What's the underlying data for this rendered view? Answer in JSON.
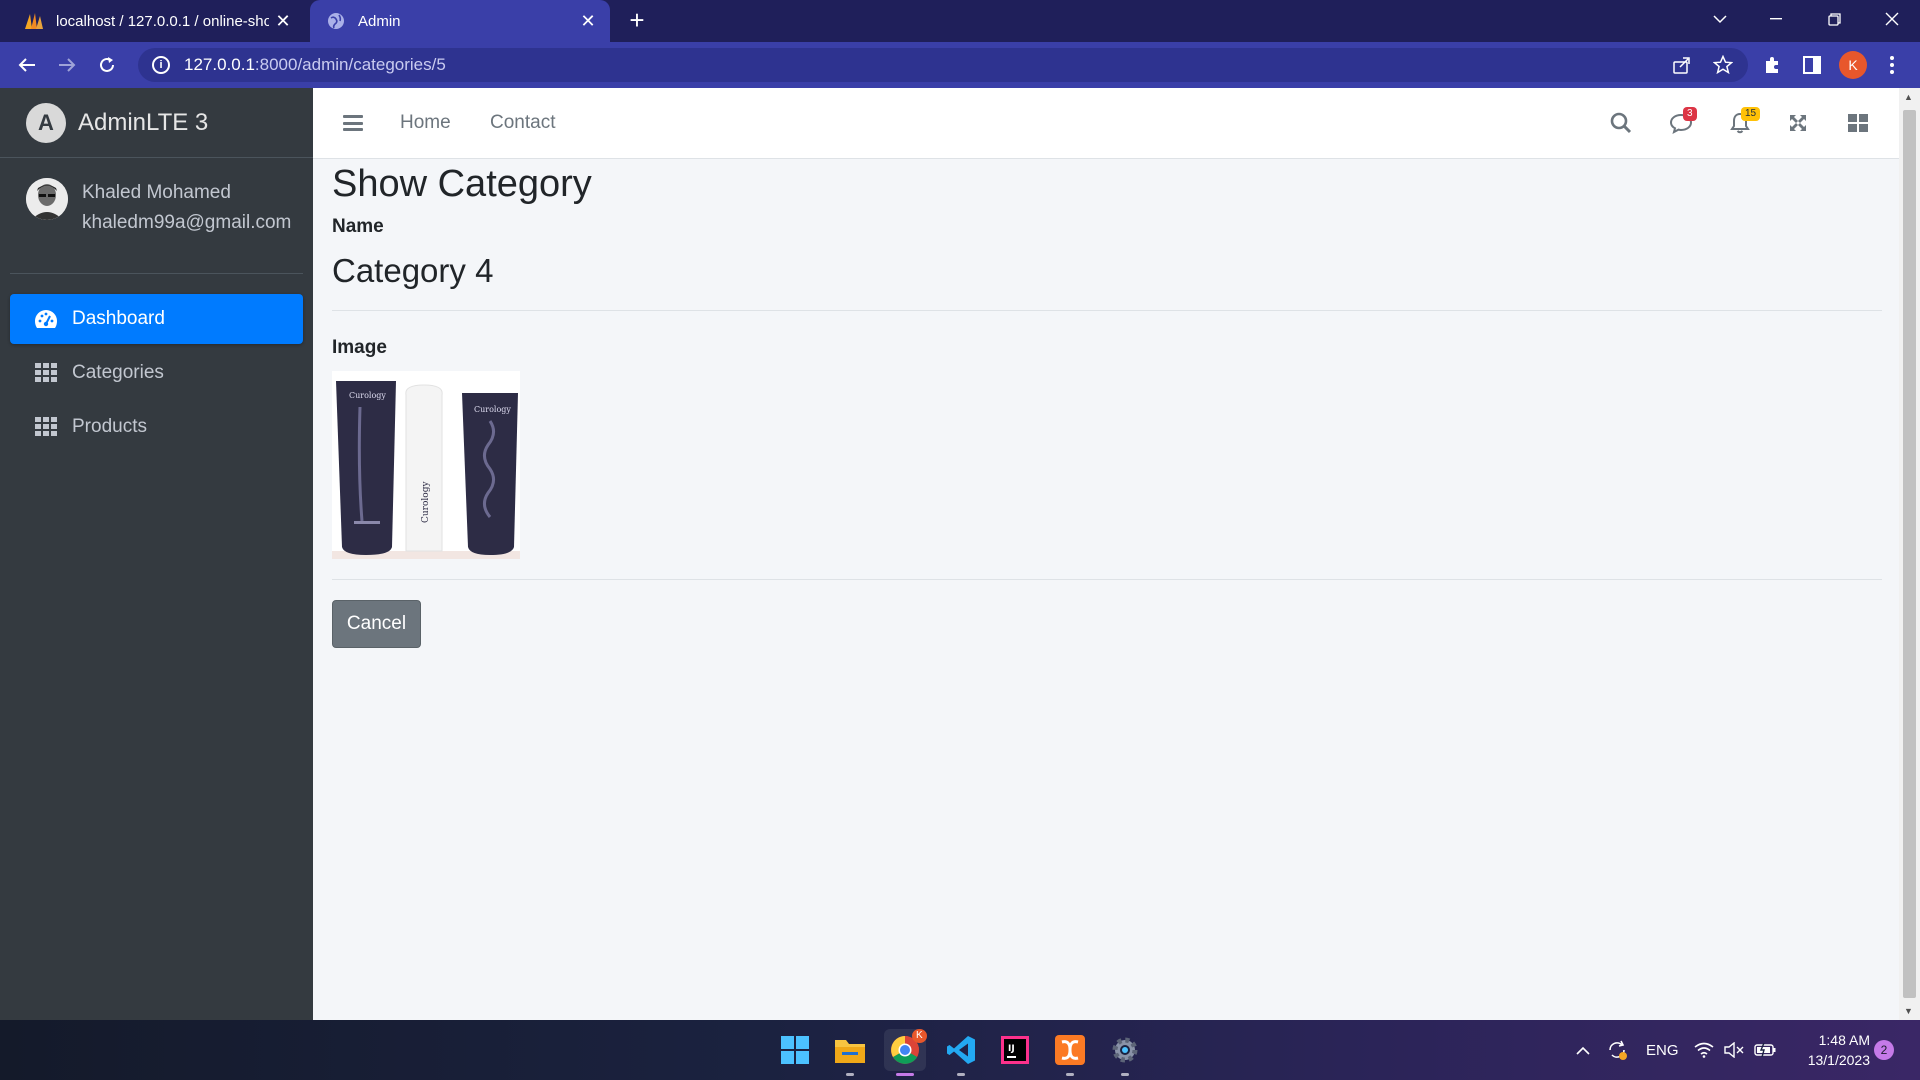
{
  "browser": {
    "tabs": [
      {
        "title": "localhost / 127.0.0.1 / online-sho",
        "favicon": "phpmyadmin-icon",
        "active": false
      },
      {
        "title": "Admin",
        "favicon": "globe-icon",
        "active": true
      }
    ],
    "address": {
      "host": "127.0.0.1",
      "path": ":8000/admin/categories/5"
    },
    "profile_initial": "K"
  },
  "sidebar": {
    "brand": "AdminLTE 3",
    "brand_logo_letter": "A",
    "user": {
      "name": "Khaled Mohamed",
      "email": "khaledm99a@gmail.com"
    },
    "items": [
      {
        "label": "Dashboard",
        "icon": "tachometer-icon",
        "active": true
      },
      {
        "label": "Categories",
        "icon": "grid-icon",
        "active": false
      },
      {
        "label": "Products",
        "icon": "grid-icon",
        "active": false
      }
    ]
  },
  "navbar": {
    "links": [
      "Home",
      "Contact"
    ],
    "messages_count": "3",
    "notifications_count": "15"
  },
  "main": {
    "title": "Show Category",
    "name_label": "Name",
    "name_value": "Category 4",
    "image_label": "Image",
    "image_brand_text": "Curology",
    "cancel_label": "Cancel"
  },
  "taskbar": {
    "tray_lang": "ENG",
    "time": "1:48 AM",
    "date": "13/1/2023",
    "notification_count": "2",
    "chrome_badge": "K"
  },
  "colors": {
    "accent": "#007bff",
    "sidebar_bg": "#343a40",
    "content_bg": "#f4f6f9",
    "cancel_btn": "#6c757d",
    "badge_red": "#dc3545",
    "badge_yellow": "#ffc107"
  }
}
